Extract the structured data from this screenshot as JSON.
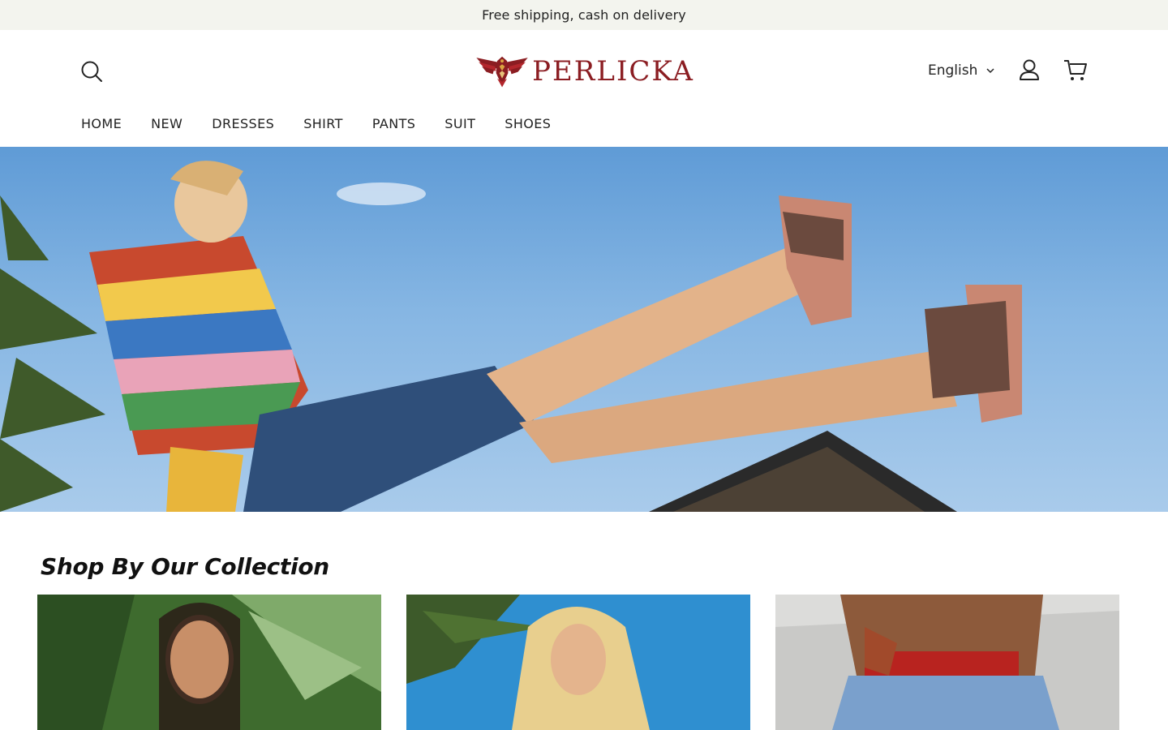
{
  "announcement": {
    "text": "Free shipping, cash on delivery"
  },
  "brand": {
    "name": "PERLICKA",
    "color": "#8b1d22"
  },
  "header": {
    "search_icon": "search-icon",
    "language": {
      "selected": "English",
      "icon": "chevron-down-icon"
    },
    "account_icon": "user-icon",
    "cart_icon": "cart-icon"
  },
  "nav": {
    "items": [
      {
        "label": "HOME"
      },
      {
        "label": "NEW"
      },
      {
        "label": "DRESSES"
      },
      {
        "label": "SHIRT"
      },
      {
        "label": "PANTS"
      },
      {
        "label": "SUIT"
      },
      {
        "label": "SHOES"
      }
    ]
  },
  "collection": {
    "title": "Shop By Our Collection"
  }
}
